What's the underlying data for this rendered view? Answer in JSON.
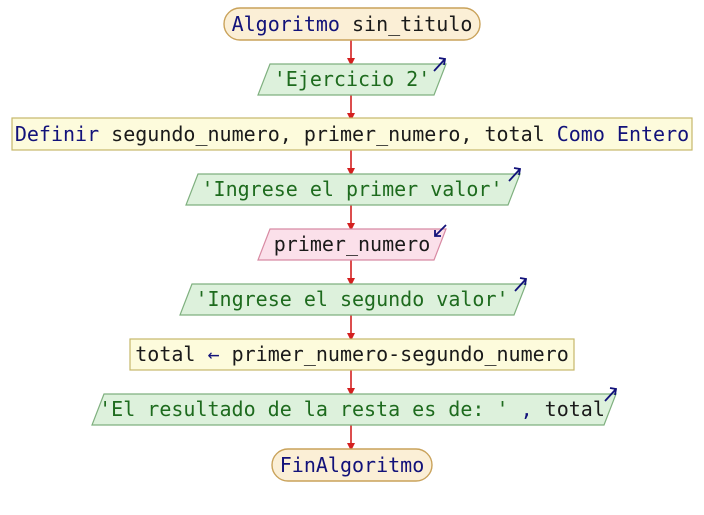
{
  "flowchart": {
    "start": {
      "keyword": "Algoritmo",
      "name": "sin_titulo"
    },
    "output_1": {
      "text": "'Ejercicio 2'"
    },
    "define": {
      "keyword": "Definir",
      "vars": "segundo_numero, primer_numero, total",
      "type": "Como Entero"
    },
    "output_2": {
      "text": "'Ingrese el primer valor'"
    },
    "input_1": {
      "var": "primer_numero"
    },
    "output_3": {
      "text": "'Ingrese el segundo valor'"
    },
    "assign": {
      "target": "total",
      "op": "←",
      "expr": "primer_numero-segundo_numero"
    },
    "output_4": {
      "text": "'El resultado de la resta es de: '",
      "sep": ",",
      "var": "total"
    },
    "end": {
      "keyword": "FinAlgoritmo"
    }
  },
  "colors": {
    "terminal_fill": "#fbefd6",
    "terminal_stroke": "#c9a25a",
    "output_fill": "#ddf1dc",
    "output_stroke": "#7fb07f",
    "input_fill": "#fbe0ea",
    "input_stroke": "#d88aa3",
    "process_fill": "#fdfbdc",
    "process_stroke": "#c6b86a",
    "arrow": "#d42020",
    "keyword": "#12127a",
    "string": "#1e6b1e",
    "io_arrow": "#12127a"
  }
}
